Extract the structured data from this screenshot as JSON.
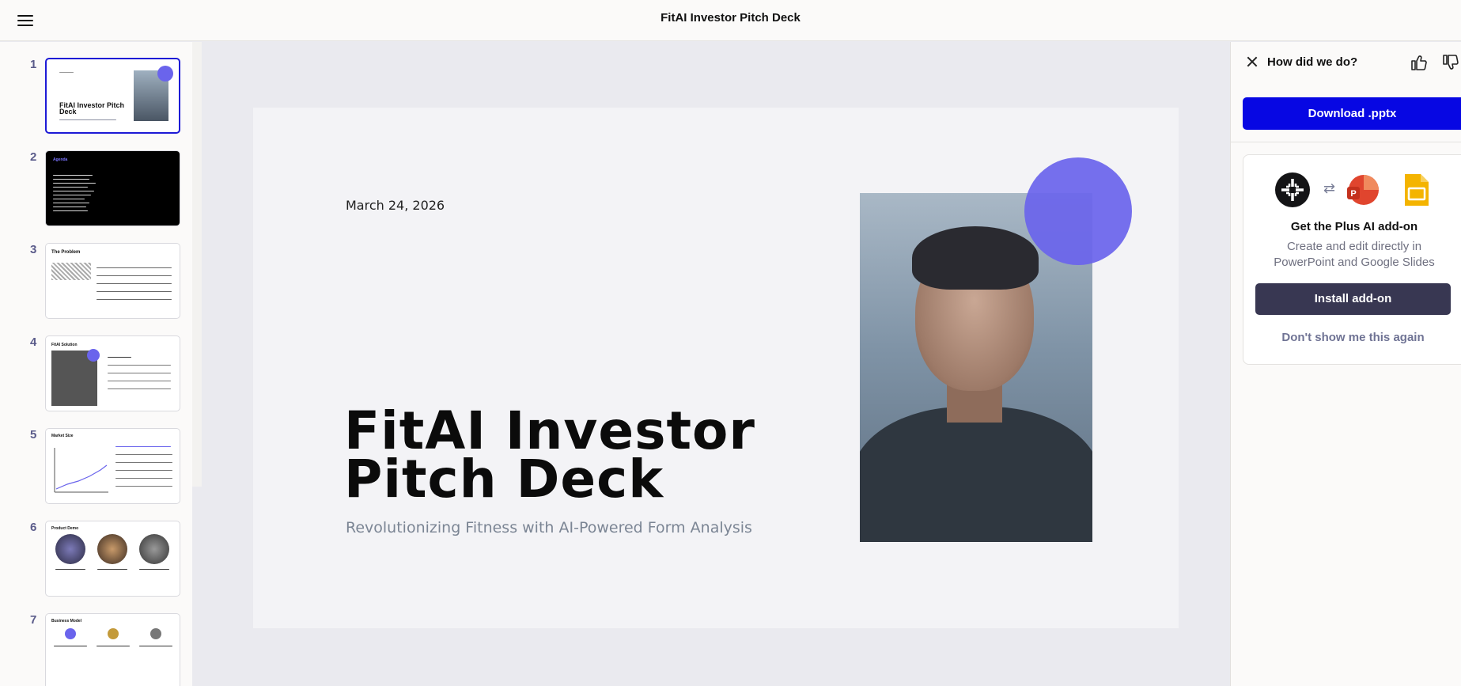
{
  "header": {
    "title": "FitAI Investor Pitch Deck",
    "menu_icon": "hamburger-menu-icon"
  },
  "sidebar": {
    "slides": [
      {
        "number": "1",
        "active": true,
        "title": "FitAI Investor Pitch Deck"
      },
      {
        "number": "2",
        "active": false,
        "title": "Agenda"
      },
      {
        "number": "3",
        "active": false,
        "title": "The Problem"
      },
      {
        "number": "4",
        "active": false,
        "title": "FitAI Solution"
      },
      {
        "number": "5",
        "active": false,
        "title": "Market Size"
      },
      {
        "number": "6",
        "active": false,
        "title": "Product Demo"
      },
      {
        "number": "7",
        "active": false,
        "title": "Business Model"
      }
    ]
  },
  "slide": {
    "date": "March 24, 2026",
    "title": "FitAI Investor Pitch Deck",
    "subtitle": "Revolutionizing Fitness with AI-Powered Form Analysis",
    "accent_color": "#6a64ec"
  },
  "panel": {
    "feedback_label": "How did we do?",
    "download_label": "Download .pptx",
    "addon_title": "Get the Plus AI add-on",
    "addon_description": "Create and edit directly in PowerPoint and Google Slides",
    "install_label": "Install add-on",
    "dismiss_label": "Don't show me this again",
    "icons": [
      "close-icon",
      "thumbs-up-icon",
      "thumbs-down-icon",
      "plus-ai-logo-icon",
      "swap-arrows-icon",
      "powerpoint-icon",
      "google-slides-icon"
    ]
  },
  "colors": {
    "primary_button": "#0707e3",
    "install_button": "#383752",
    "active_thumb_border": "#1d1ad6"
  }
}
